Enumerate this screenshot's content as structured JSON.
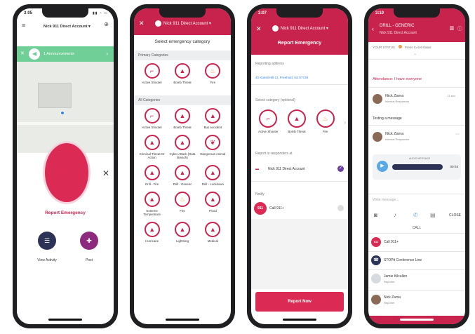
{
  "p1": {
    "time": "3:05",
    "account": "Nick 911 Direct Account",
    "announcements": "1 Announcements",
    "report_label": "Report Emergency",
    "view_activity": "View Activity",
    "post": "Post"
  },
  "p2": {
    "account": "Nick 911 Direct Account",
    "title": "Select emergency category",
    "primary_header": "Primary Categories",
    "primary": [
      "Active Shooter",
      "Bomb Threat",
      "Fire"
    ],
    "all_header": "All Categories",
    "all": [
      "Active Shooter",
      "Bomb Threat",
      "Bus Accident",
      "Criminal Threat Or Action",
      "Cyber Attack (Data Breach)",
      "Dangerous Animal",
      "Drill - Fire",
      "Drill - Generic",
      "Drill - Lockdown",
      "Extreme Temperature",
      "Fire",
      "Flood",
      "Hurricane",
      "Lightning",
      "Medical"
    ]
  },
  "p3": {
    "time": "3:07",
    "account": "Nick 911 Direct Account",
    "title": "Report Emergency",
    "reporting_label": "Reporting address",
    "address": "40 Kossil Hill Ct, Freehold, NJ 07728",
    "cat_label": "Select category (optional)",
    "cats": [
      "Active Shooter",
      "Bomb Threat",
      "Fire"
    ],
    "responders_label": "Report to responders at",
    "responder_name": "Nick 911 Direct Account",
    "notify_label": "Notify",
    "call_label": "Call 911+",
    "report_now": "Report Now"
  },
  "p4": {
    "time": "3:10",
    "title": "DRILL - GENERIC",
    "account": "Nick 911 Direct Account",
    "status_label": "YOUR STATUS",
    "status_value": "Press to set status",
    "attendance": "Attendance: I have everyone",
    "msg1_name": "Nick Zama",
    "msg1_role": "Internal Responder",
    "msg1_time": "11 sec",
    "msg1_text": "Testing a message",
    "msg2_name": "Nick Zama",
    "msg2_role": "Internal Responder",
    "audio_label": "AUDIO MESSAGE",
    "audio_time": "00:03",
    "compose_placeholder": "Write message...",
    "close_label": "CLOSE",
    "call_header": "CALL",
    "contacts": [
      {
        "name": "Call 911+",
        "role": ""
      },
      {
        "name": "STOPit Conference Line",
        "role": ""
      },
      {
        "name": "Jamie Kilcullen",
        "role": "Reporter"
      },
      {
        "name": "Nick Zama",
        "role": "Reporter"
      }
    ]
  }
}
